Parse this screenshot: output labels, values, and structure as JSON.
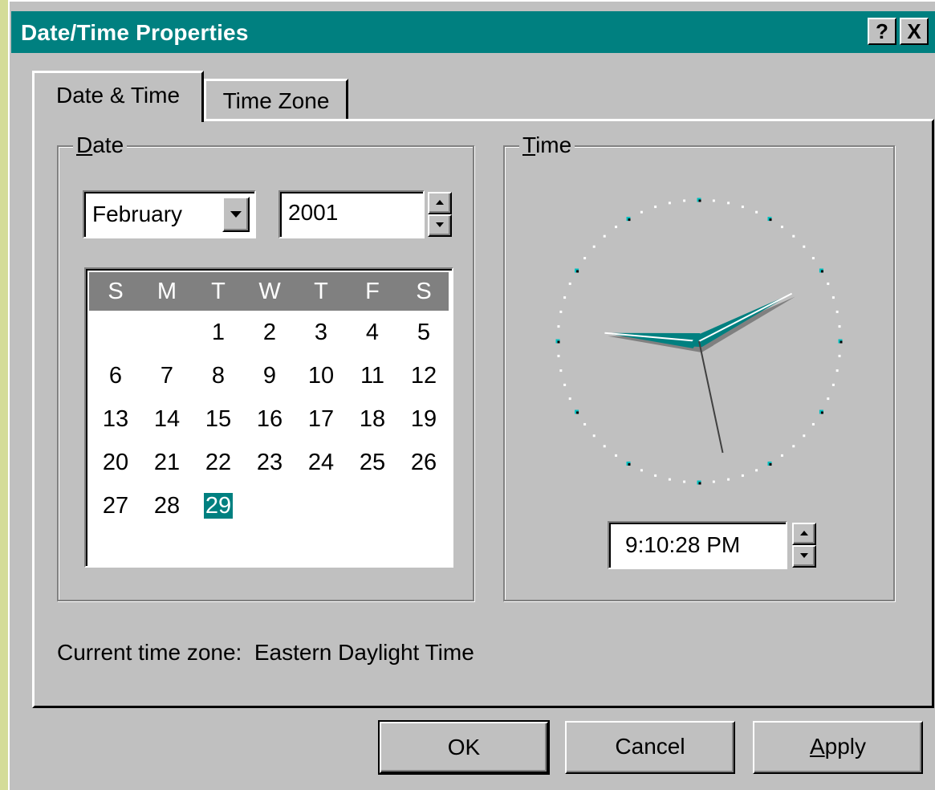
{
  "window": {
    "title": "Date/Time Properties",
    "help_glyph": "?",
    "close_glyph": "X"
  },
  "tabs": [
    {
      "label": "Date & Time",
      "active": true
    },
    {
      "label": "Time Zone",
      "active": false
    }
  ],
  "date_group": {
    "label_prefix": "D",
    "label_rest": "ate",
    "month": "February",
    "year": "2001",
    "calendar": {
      "weekdays": [
        "S",
        "M",
        "T",
        "W",
        "T",
        "F",
        "S"
      ],
      "weeks": [
        [
          "",
          "",
          "1",
          "2",
          "3",
          "4",
          "5"
        ],
        [
          "6",
          "7",
          "8",
          "9",
          "10",
          "11",
          "12"
        ],
        [
          "13",
          "14",
          "15",
          "16",
          "17",
          "18",
          "19"
        ],
        [
          "20",
          "21",
          "22",
          "23",
          "24",
          "25",
          "26"
        ],
        [
          "27",
          "28",
          "29",
          "",
          "",
          "",
          ""
        ]
      ],
      "selected_day": "29"
    }
  },
  "time_group": {
    "label_prefix": "T",
    "label_rest": "ime",
    "time_value": "9:10:28 PM",
    "clock": {
      "hour": 9,
      "minute": 10,
      "second": 28
    }
  },
  "current_time_zone_text": "Current time zone:  Eastern Daylight Time",
  "buttons": {
    "ok": "OK",
    "cancel": "Cancel",
    "apply_prefix": "A",
    "apply_rest": "pply"
  },
  "colors": {
    "titlebar": "#008080",
    "selection": "#008080",
    "clock_hand": "#008080",
    "clock_dot_major": "#00c0c0"
  },
  "icons": [
    "dropdown-arrow-icon",
    "spin-up-icon",
    "spin-down-icon",
    "help-icon",
    "close-icon"
  ]
}
